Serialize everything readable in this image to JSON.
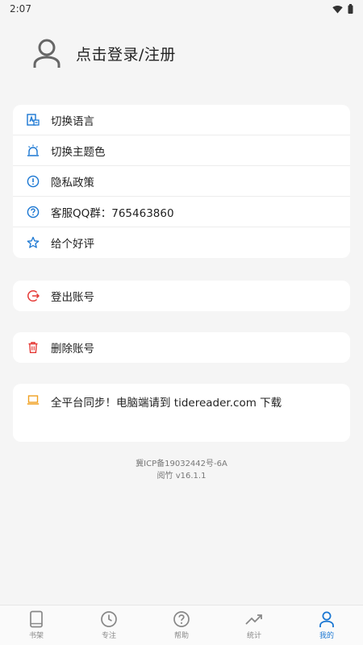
{
  "status_bar": {
    "time": "2:07"
  },
  "profile": {
    "login_label": "点击登录/注册"
  },
  "settings": {
    "items": [
      {
        "label": "切换语言",
        "icon": "translate-icon"
      },
      {
        "label": "切换主题色",
        "icon": "theme-color-icon"
      },
      {
        "label": "隐私政策",
        "icon": "info-circle-icon"
      },
      {
        "label": "客服QQ群：765463860",
        "icon": "help-circle-icon"
      },
      {
        "label": "给个好评",
        "icon": "star-icon"
      }
    ]
  },
  "account": {
    "logout_label": "登出账号",
    "delete_label": "删除账号"
  },
  "sync": {
    "text": "全平台同步！电脑端请到 tidereader.com 下载"
  },
  "footer": {
    "icp": "冀ICP备19032442号-6A",
    "version": "阅竹 v16.1.1"
  },
  "tabs": [
    {
      "label": "书架",
      "icon": "book-icon",
      "active": false
    },
    {
      "label": "专注",
      "icon": "clock-icon",
      "active": false
    },
    {
      "label": "帮助",
      "icon": "help-icon",
      "active": false
    },
    {
      "label": "统计",
      "icon": "trend-icon",
      "active": false
    },
    {
      "label": "我的",
      "icon": "person-icon",
      "active": true
    }
  ],
  "colors": {
    "accent": "#1976d2",
    "danger": "#e53935",
    "warning": "#f0a020"
  }
}
